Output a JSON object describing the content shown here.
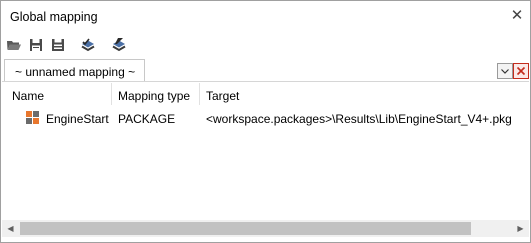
{
  "window": {
    "title": "Global mapping",
    "close_glyph": "✕"
  },
  "toolbar": {
    "buttons": [
      {
        "icon": "open-folder-icon"
      },
      {
        "icon": "save-icon"
      },
      {
        "icon": "save-as-icon"
      },
      {
        "icon": "check-apply-icon"
      },
      {
        "icon": "edit-apply-icon"
      }
    ]
  },
  "tabs": [
    {
      "label": "~ unnamed mapping ~",
      "active": true
    }
  ],
  "table": {
    "columns": [
      "Name",
      "Mapping type",
      "Target"
    ],
    "rows": [
      {
        "name": "EngineStart",
        "mapping_type": "PACKAGE",
        "target": "<workspace.packages>\\Results\\Lib\\EngineStart_V4+.pkg",
        "icon": "package-icon"
      }
    ]
  },
  "colors": {
    "package_icon": "#e8772e",
    "package_icon_dark": "#6b6b6b",
    "tab_close": "#c42b1c"
  }
}
